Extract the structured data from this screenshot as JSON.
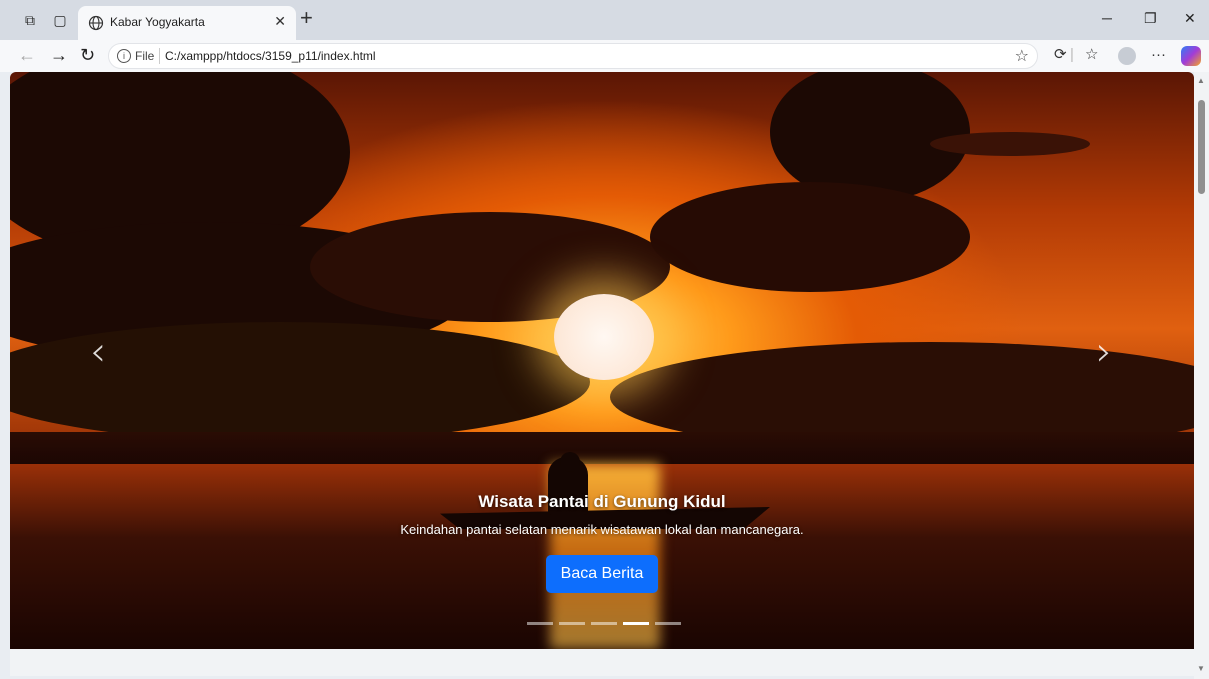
{
  "browser": {
    "tab_title": "Kabar Yogyakarta",
    "new_tab_label": "+",
    "url_scheme": "File",
    "url": "C:/xamppp/htdocs/3159_p11/index.html"
  },
  "carousel": {
    "slide_title": "Wisata Pantai di Gunung Kidul",
    "slide_text": "Keindahan pantai selatan menarik wisatawan lokal dan mancanegara.",
    "button_label": "Baca Berita",
    "prev_label": "‹",
    "next_label": "›",
    "indicator_count": 5,
    "active_indicator": 4
  },
  "icons": {
    "back": "arrow-left-icon",
    "forward": "arrow-right-icon",
    "refresh": "refresh-icon",
    "favorite": "star-icon"
  }
}
